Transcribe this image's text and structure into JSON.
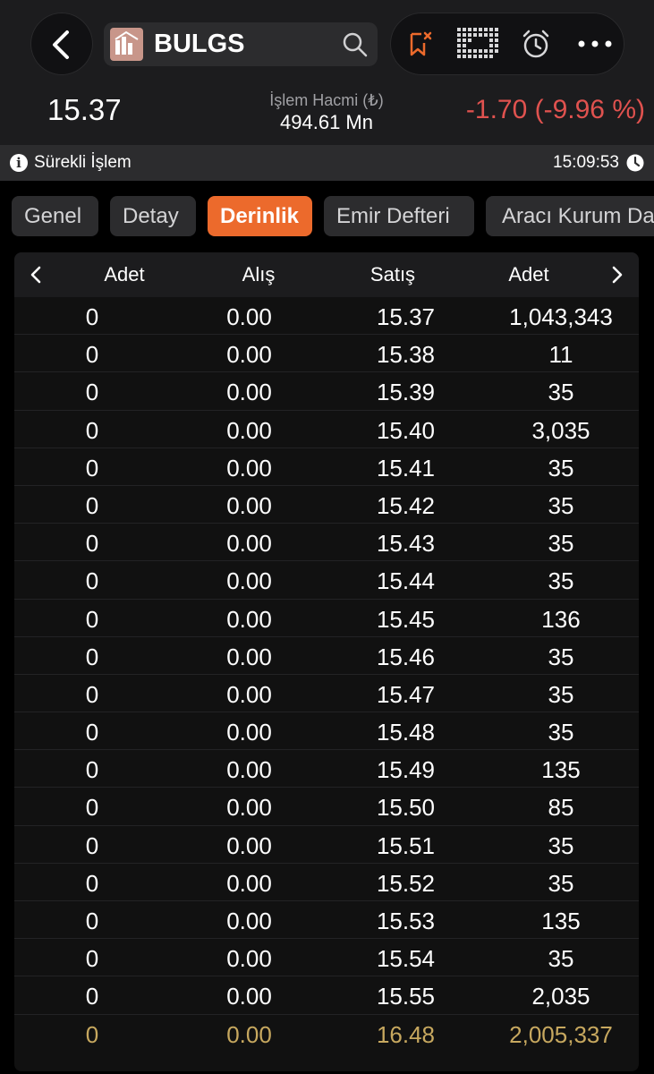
{
  "header": {
    "symbol": "BULGS",
    "price": "15.37",
    "volume_label": "İşlem Hacmi (₺)",
    "volume_value": "494.61 Mn",
    "change": "-1.70 (-9.96 %)"
  },
  "status": {
    "label": "Sürekli İşlem",
    "time": "15:09:53"
  },
  "tabs": [
    {
      "label": "Genel"
    },
    {
      "label": "Detay"
    },
    {
      "label": "Derinlik"
    },
    {
      "label": "Emir Defteri"
    },
    {
      "label": "Aracı Kurum Da"
    }
  ],
  "active_tab": "Derinlik",
  "table": {
    "columns": [
      "Adet",
      "Alış",
      "Satış",
      "Adet"
    ],
    "rows": [
      {
        "bid_qty": "0",
        "bid": "0.00",
        "ask": "15.37",
        "ask_qty": "1,043,343"
      },
      {
        "bid_qty": "0",
        "bid": "0.00",
        "ask": "15.38",
        "ask_qty": "11"
      },
      {
        "bid_qty": "0",
        "bid": "0.00",
        "ask": "15.39",
        "ask_qty": "35"
      },
      {
        "bid_qty": "0",
        "bid": "0.00",
        "ask": "15.40",
        "ask_qty": "3,035"
      },
      {
        "bid_qty": "0",
        "bid": "0.00",
        "ask": "15.41",
        "ask_qty": "35"
      },
      {
        "bid_qty": "0",
        "bid": "0.00",
        "ask": "15.42",
        "ask_qty": "35"
      },
      {
        "bid_qty": "0",
        "bid": "0.00",
        "ask": "15.43",
        "ask_qty": "35"
      },
      {
        "bid_qty": "0",
        "bid": "0.00",
        "ask": "15.44",
        "ask_qty": "35"
      },
      {
        "bid_qty": "0",
        "bid": "0.00",
        "ask": "15.45",
        "ask_qty": "136"
      },
      {
        "bid_qty": "0",
        "bid": "0.00",
        "ask": "15.46",
        "ask_qty": "35"
      },
      {
        "bid_qty": "0",
        "bid": "0.00",
        "ask": "15.47",
        "ask_qty": "35"
      },
      {
        "bid_qty": "0",
        "bid": "0.00",
        "ask": "15.48",
        "ask_qty": "35"
      },
      {
        "bid_qty": "0",
        "bid": "0.00",
        "ask": "15.49",
        "ask_qty": "135"
      },
      {
        "bid_qty": "0",
        "bid": "0.00",
        "ask": "15.50",
        "ask_qty": "85"
      },
      {
        "bid_qty": "0",
        "bid": "0.00",
        "ask": "15.51",
        "ask_qty": "35"
      },
      {
        "bid_qty": "0",
        "bid": "0.00",
        "ask": "15.52",
        "ask_qty": "35"
      },
      {
        "bid_qty": "0",
        "bid": "0.00",
        "ask": "15.53",
        "ask_qty": "135"
      },
      {
        "bid_qty": "0",
        "bid": "0.00",
        "ask": "15.54",
        "ask_qty": "35"
      },
      {
        "bid_qty": "0",
        "bid": "0.00",
        "ask": "15.55",
        "ask_qty": "2,035"
      },
      {
        "bid_qty": "0",
        "bid": "0.00",
        "ask": "16.48",
        "ask_qty": "2,005,337",
        "highlight": true
      }
    ]
  },
  "colors": {
    "accent": "#ec6a2c",
    "negative": "#e0524f",
    "total_row": "#c7a85f"
  },
  "icons": [
    "back-icon",
    "logo-icon",
    "search-icon",
    "bookmark-remove-icon",
    "grid-icon",
    "alarm-icon",
    "more-icon",
    "info-icon",
    "clock-icon",
    "chevron-left-icon",
    "chevron-right-icon"
  ]
}
